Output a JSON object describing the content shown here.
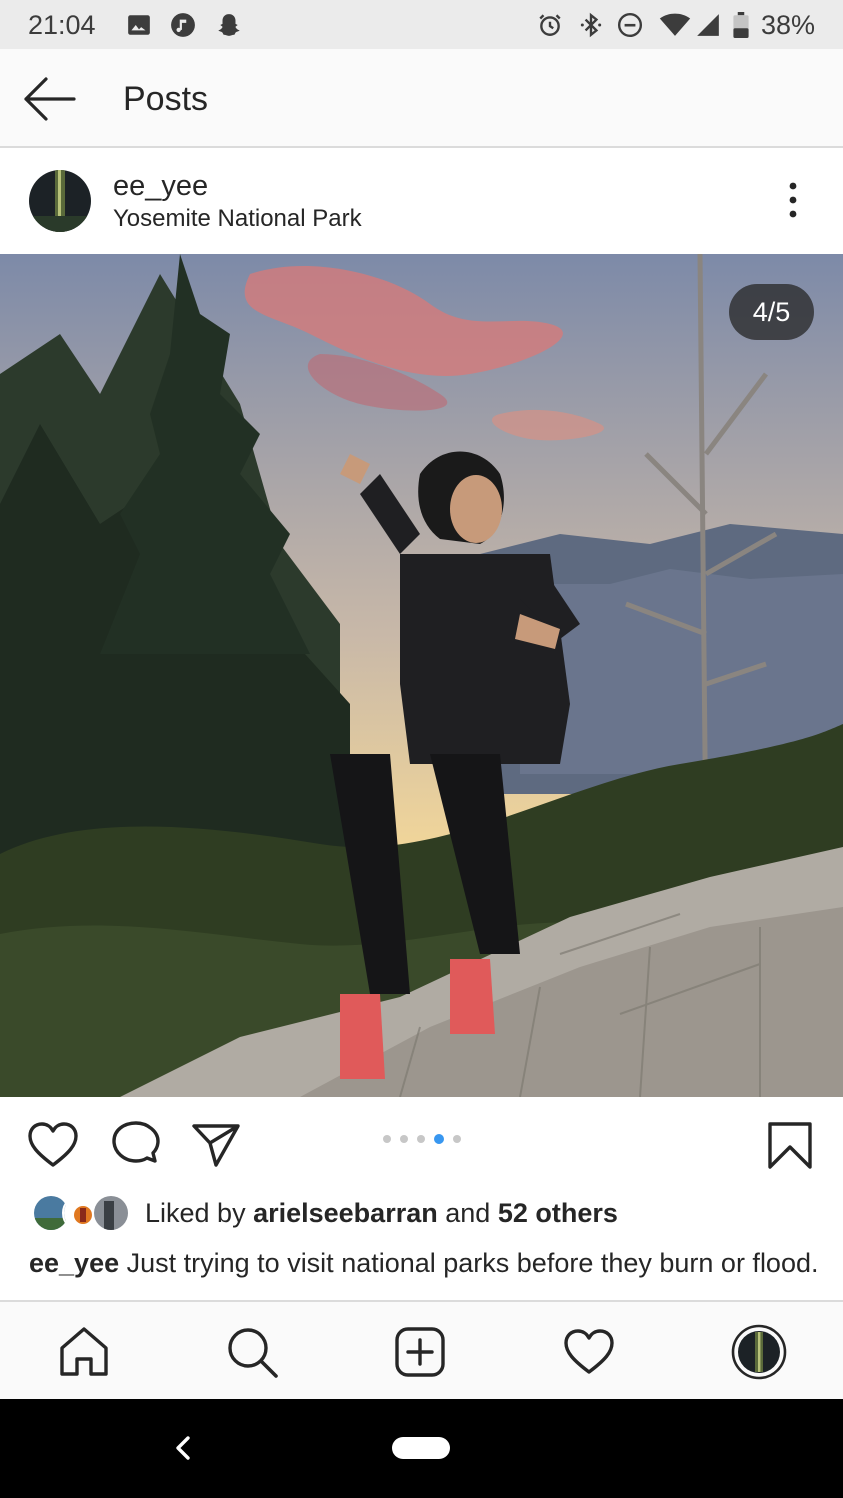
{
  "status_bar": {
    "time": "21:04",
    "battery_percent": "38%",
    "left_icons": [
      "image-icon",
      "music-note-icon",
      "snapchat-ghost-icon"
    ],
    "right_icons": [
      "alarm-icon",
      "bluetooth-icon",
      "do-not-disturb-icon",
      "wifi-icon",
      "signal-icon",
      "battery-icon"
    ]
  },
  "header": {
    "title": "Posts",
    "back_icon": "arrow-left-icon"
  },
  "post": {
    "username": "ee_yee",
    "location": "Yosemite National Park",
    "more_icon": "more-vertical-icon",
    "image_counter": "4/5",
    "carousel": {
      "total": 5,
      "active_index": 3
    },
    "likes": {
      "prefix": "Liked by",
      "user": "arielseebarran",
      "joiner": "and",
      "others": "52 others"
    },
    "caption": {
      "username": "ee_yee",
      "text": "Just trying to visit national parks before they burn or flood."
    }
  },
  "actions": [
    "heart-icon",
    "comment-icon",
    "send-icon",
    "bookmark-icon"
  ],
  "bottom_nav": [
    "home-icon",
    "search-icon",
    "new-post-icon",
    "activity-heart-icon",
    "profile-avatar"
  ],
  "colors": {
    "accent_blue": "#3897f0",
    "text": "#262626",
    "divider": "#dbdbdb"
  }
}
